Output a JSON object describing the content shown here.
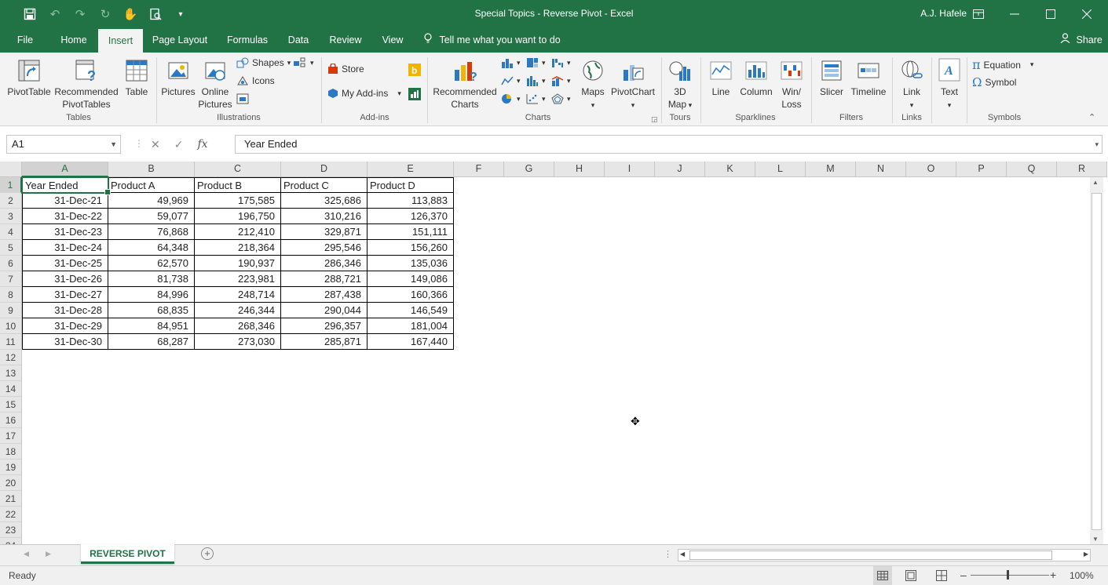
{
  "titlebar": {
    "title": "Special Topics - Reverse Pivot  -  Excel",
    "user": "A.J. Hafele",
    "qat_icons": [
      "save-icon",
      "undo-icon",
      "redo-icon",
      "refresh-icon",
      "touch-mode-icon",
      "print-preview-icon",
      "customize-qat-icon"
    ],
    "colors": {
      "brand": "#217346"
    }
  },
  "tabs": [
    {
      "label": "File"
    },
    {
      "label": "Home"
    },
    {
      "label": "Insert",
      "active": true
    },
    {
      "label": "Page Layout"
    },
    {
      "label": "Formulas"
    },
    {
      "label": "Data"
    },
    {
      "label": "Review"
    },
    {
      "label": "View"
    }
  ],
  "tellme": "Tell me what you want to do",
  "share": "Share",
  "ribbon": {
    "tables": {
      "label": "Tables",
      "pivottable": "PivotTable",
      "recommended_pt_1": "Recommended",
      "recommended_pt_2": "PivotTables",
      "table": "Table"
    },
    "illustrations": {
      "label": "Illustrations",
      "pictures": "Pictures",
      "online_1": "Online",
      "online_2": "Pictures",
      "shapes": "Shapes",
      "icons": "Icons"
    },
    "addins": {
      "label": "Add-ins",
      "store": "Store",
      "my_addins": "My Add-ins"
    },
    "charts": {
      "label": "Charts",
      "recommended_1": "Recommended",
      "recommended_2": "Charts",
      "maps": "Maps",
      "pivotchart": "PivotChart"
    },
    "tours": {
      "label": "Tours",
      "map3d_1": "3D",
      "map3d_2": "Map"
    },
    "sparklines": {
      "label": "Sparklines",
      "line": "Line",
      "column": "Column",
      "winloss_1": "Win/",
      "winloss_2": "Loss"
    },
    "filters": {
      "label": "Filters",
      "slicer": "Slicer",
      "timeline": "Timeline"
    },
    "links": {
      "label": "Links",
      "link": "Link"
    },
    "text": {
      "text": "Text"
    },
    "symbols": {
      "label": "Symbols",
      "equation": "Equation",
      "symbol": "Symbol"
    }
  },
  "formula_bar": {
    "name_box": "A1",
    "content": "Year Ended",
    "fx": "fx"
  },
  "sheet": {
    "columns": [
      "A",
      "B",
      "C",
      "D",
      "E",
      "F",
      "G",
      "H",
      "I",
      "J",
      "K",
      "L",
      "M",
      "N",
      "O",
      "P",
      "Q",
      "R"
    ],
    "rows": [
      "1",
      "2",
      "3",
      "4",
      "5",
      "6",
      "7",
      "8",
      "9",
      "10",
      "11",
      "12",
      "13",
      "14",
      "15",
      "16",
      "17",
      "18",
      "19",
      "20",
      "21",
      "22",
      "23",
      "24"
    ],
    "headers": [
      "Year Ended",
      "Product A",
      "Product B",
      "Product C",
      "Product D"
    ],
    "data": [
      [
        "31-Dec-21",
        "49,969",
        "175,585",
        "325,686",
        "113,883"
      ],
      [
        "31-Dec-22",
        "59,077",
        "196,750",
        "310,216",
        "126,370"
      ],
      [
        "31-Dec-23",
        "76,868",
        "212,410",
        "329,871",
        "151,111"
      ],
      [
        "31-Dec-24",
        "64,348",
        "218,364",
        "295,546",
        "156,260"
      ],
      [
        "31-Dec-25",
        "62,570",
        "190,937",
        "286,346",
        "135,036"
      ],
      [
        "31-Dec-26",
        "81,738",
        "223,981",
        "288,721",
        "149,086"
      ],
      [
        "31-Dec-27",
        "84,996",
        "248,714",
        "287,438",
        "160,366"
      ],
      [
        "31-Dec-28",
        "68,835",
        "246,344",
        "290,044",
        "146,549"
      ],
      [
        "31-Dec-29",
        "84,951",
        "268,346",
        "296,357",
        "181,004"
      ],
      [
        "31-Dec-30",
        "68,287",
        "273,030",
        "285,871",
        "167,440"
      ]
    ]
  },
  "sheet_tabs": [
    {
      "label": "REVERSE PIVOT",
      "active": true
    }
  ],
  "status": {
    "text": "Ready",
    "zoom": "100%"
  }
}
